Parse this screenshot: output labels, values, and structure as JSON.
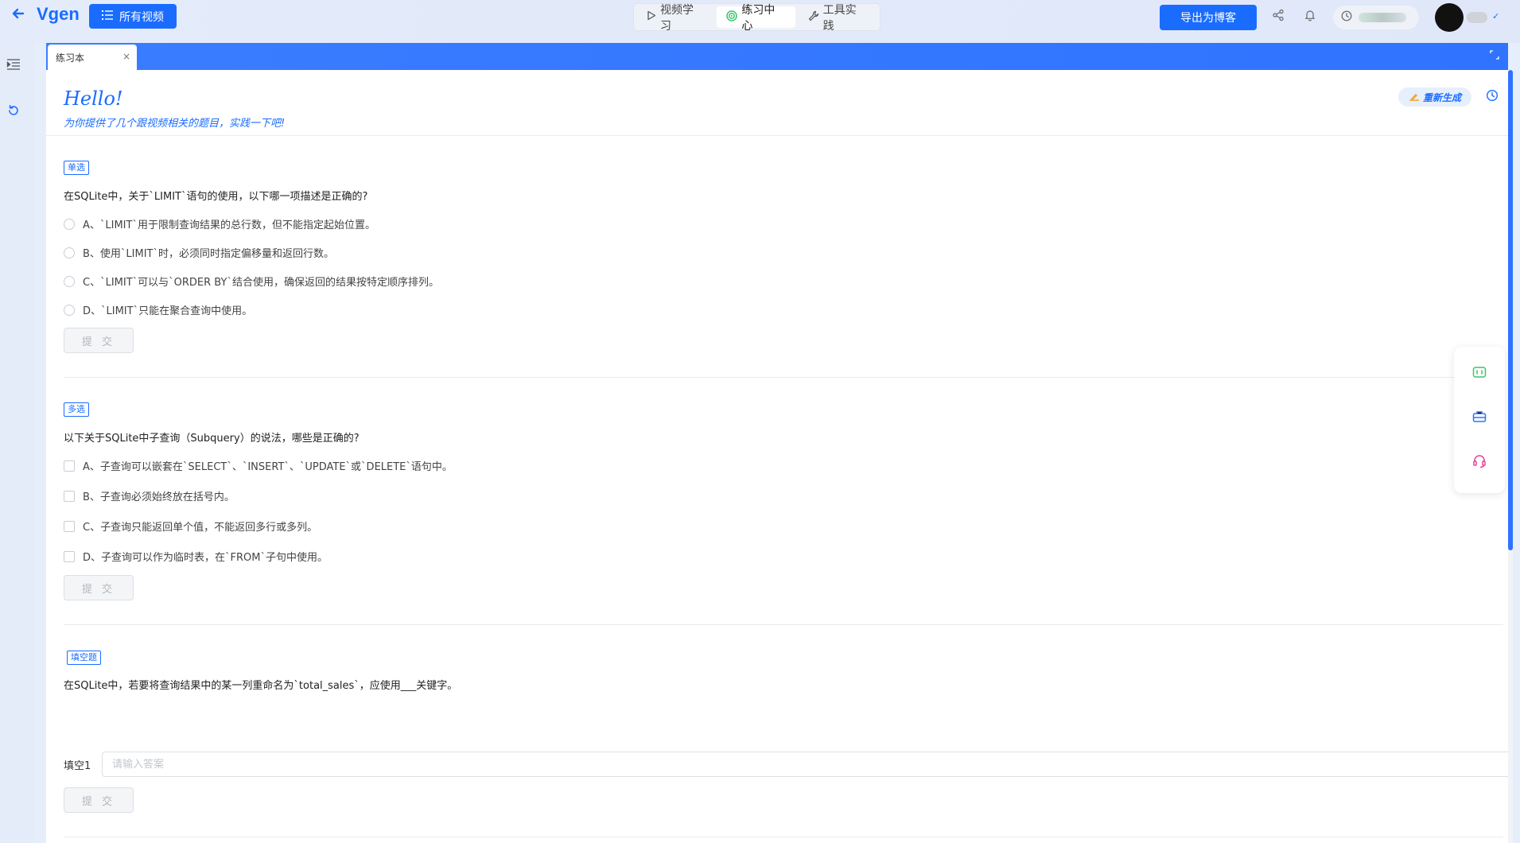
{
  "topbar": {
    "logo": "Vgen",
    "all_videos_label": "所有视频",
    "tabs": [
      {
        "label": "视频学习",
        "active": false
      },
      {
        "label": "练习中心",
        "active": true
      },
      {
        "label": "工具实践",
        "active": false
      }
    ],
    "export_label": "导出为博客"
  },
  "colors": {
    "primary": "#1a6cff",
    "tabstrip": "#2f73ff",
    "disabled_text": "#b3b7bd",
    "icon_green": "#3cc46a",
    "icon_blue": "#2f73ff",
    "icon_pink": "#e0449b"
  },
  "panel": {
    "tab_label": "练习本",
    "tab_close": "×",
    "hello": "Hello!",
    "hello_sub": "为你提供了几个跟视频相关的题目，实践一下吧!",
    "regenerate_label": "重新生成"
  },
  "questions": [
    {
      "type": "单选",
      "text": "在SQLite中，关于`LIMIT`语句的使用，以下哪一项描述是正确的?",
      "options": [
        "A、`LIMIT`用于限制查询结果的总行数，但不能指定起始位置。",
        "B、使用`LIMIT`时，必须同时指定偏移量和返回行数。",
        "C、`LIMIT`可以与`ORDER BY`结合使用，确保返回的结果按特定顺序排列。",
        "D、`LIMIT`只能在聚合查询中使用。"
      ],
      "submit_label": "提 交"
    },
    {
      "type": "多选",
      "text": "以下关于SQLite中子查询（Subquery）的说法，哪些是正确的?",
      "options": [
        "A、子查询可以嵌套在`SELECT`、`INSERT`、`UPDATE`或`DELETE`语句中。",
        "B、子查询必须始终放在括号内。",
        "C、子查询只能返回单个值，不能返回多行或多列。",
        "D、子查询可以作为临时表，在`FROM`子句中使用。"
      ],
      "submit_label": "提 交"
    },
    {
      "type": "填空题",
      "text": "在SQLite中，若要将查询结果中的某一列重命名为`total_sales`，应使用___关键字。",
      "blank_label": "填空1",
      "blank_placeholder": "请输入答案",
      "blank_value": "",
      "submit_label": "提 交"
    }
  ]
}
